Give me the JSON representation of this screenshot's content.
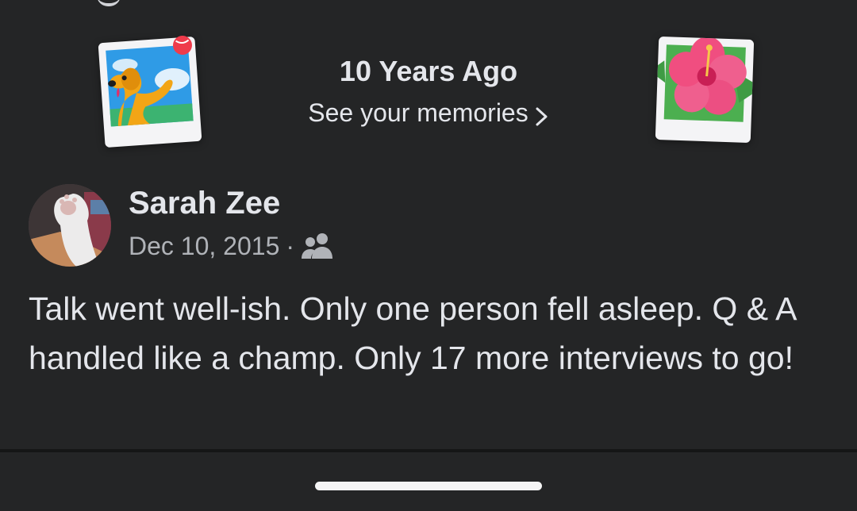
{
  "memories": {
    "title": "10 Years Ago",
    "link_label": "See your memories",
    "left_icon": "dog-photo-icon",
    "right_icon": "hibiscus-photo-icon"
  },
  "post": {
    "author": "Sarah Zee",
    "date": "Dec 10, 2015",
    "separator": "·",
    "audience_icon": "friends-icon",
    "text": "Talk went well-ish. Only one person fell asleep. Q & A handled like a champ. Only 17 more interviews to go!"
  },
  "colors": {
    "background": "#242526",
    "primary_text": "#e4e6eb",
    "secondary_text": "#b0b3b8"
  }
}
